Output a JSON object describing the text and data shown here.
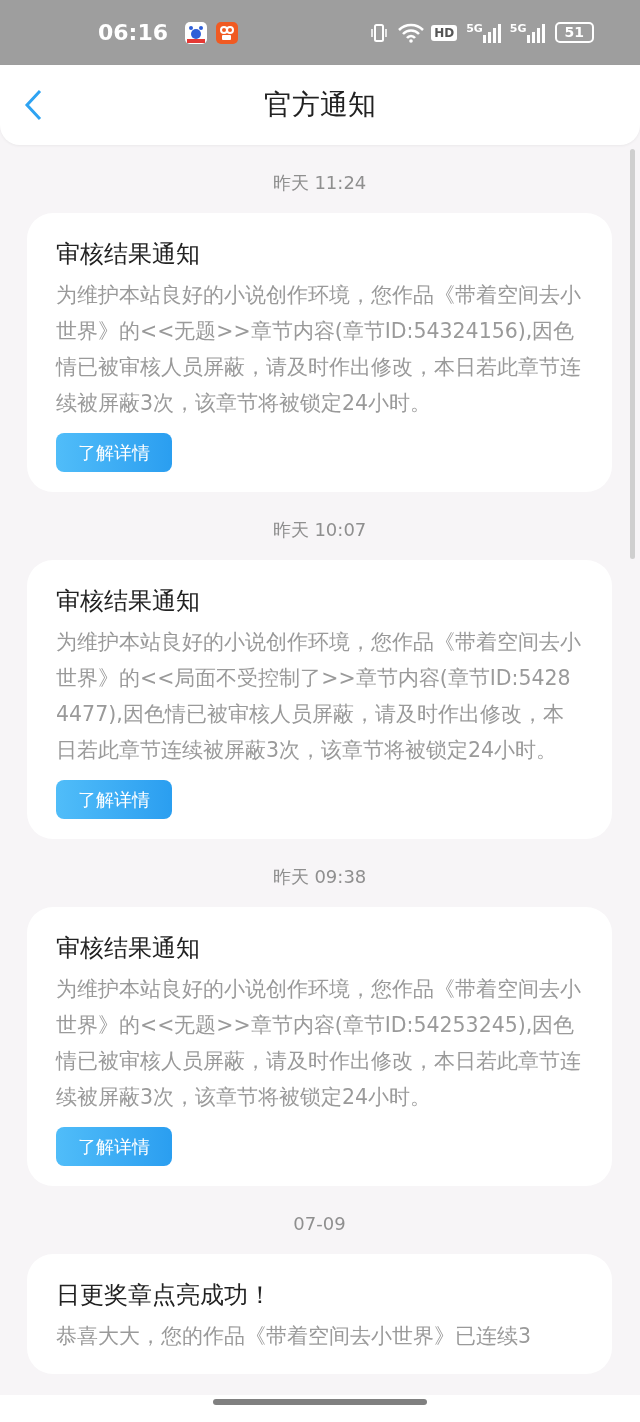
{
  "status_bar": {
    "time": "06:16",
    "hd_label": "HD",
    "signals": [
      "5G",
      "5G"
    ],
    "battery": "51"
  },
  "header": {
    "title": "官方通知"
  },
  "messages": [
    {
      "time": "昨天 11:24",
      "title": "审核结果通知",
      "body": "为维护本站良好的小说创作环境，您作品《带着空间去小世界》的<<无题>>章节内容(章节ID:54324156),因色情已被审核人员屏蔽，请及时作出修改，本日若此章节连续被屏蔽3次，该章节将被锁定24小时。",
      "button": "了解详情"
    },
    {
      "time": "昨天 10:07",
      "title": "审核结果通知",
      "body": "为维护本站良好的小说创作环境，您作品《带着空间去小世界》的<<局面不受控制了>>章节内容(章节ID:54284477),因色情已被审核人员屏蔽，请及时作出修改，本日若此章节连续被屏蔽3次，该章节将被锁定24小时。",
      "button": "了解详情"
    },
    {
      "time": "昨天 09:38",
      "title": "审核结果通知",
      "body": "为维护本站良好的小说创作环境，您作品《带着空间去小世界》的<<无题>>章节内容(章节ID:54253245),因色情已被审核人员屏蔽，请及时作出修改，本日若此章节连续被屏蔽3次，该章节将被锁定24小时。",
      "button": "了解详情"
    },
    {
      "time": "07-09",
      "title": "日更奖章点亮成功！",
      "body": "恭喜大大，您的作品《带着空间去小世界》已连续3"
    }
  ]
}
